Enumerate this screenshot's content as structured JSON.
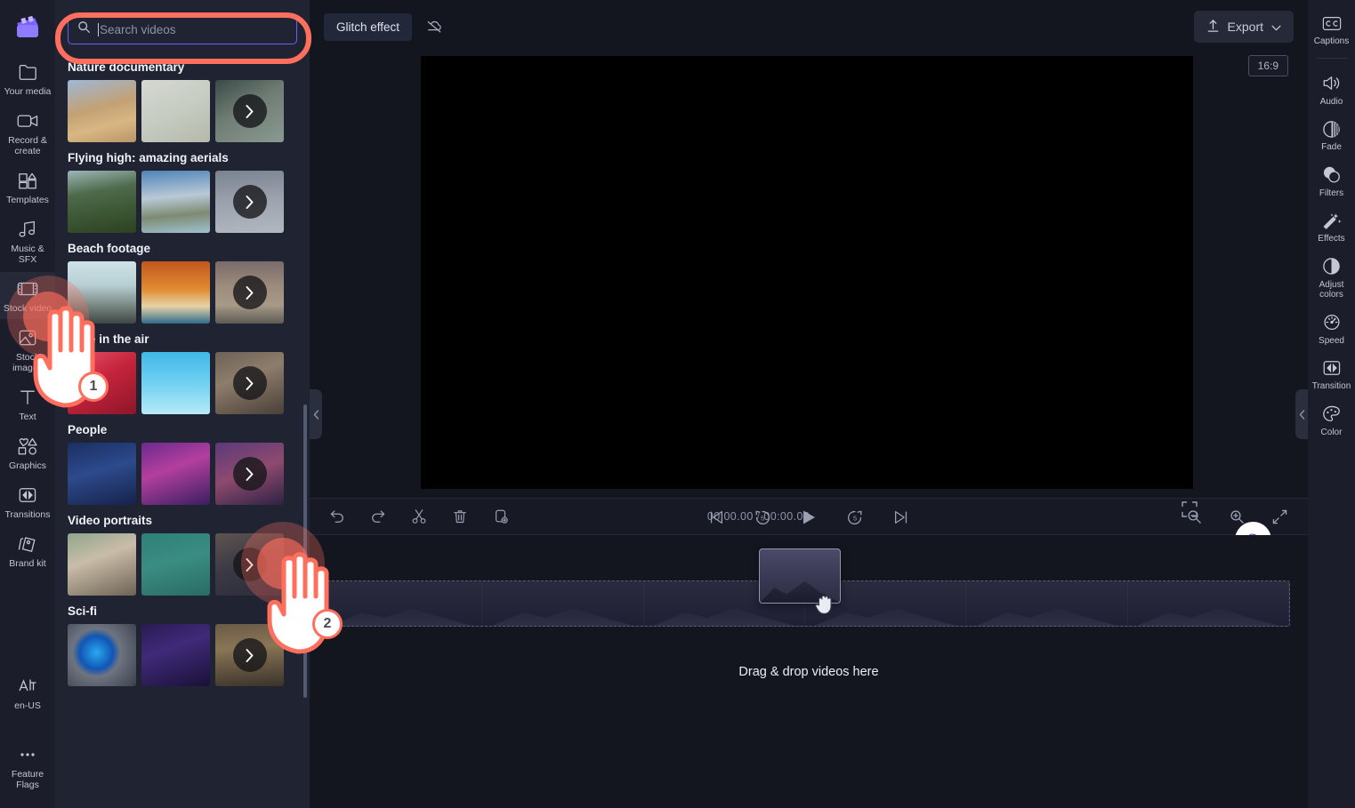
{
  "app": {
    "name": "Clipchamp video editor",
    "accent": "#6a5cff",
    "annotation_color": "#ff6f5e"
  },
  "left_rail": {
    "logo_name": "clipchamp-logo",
    "items": [
      {
        "label": "Your media",
        "icon": "folder-icon",
        "active": false
      },
      {
        "label": "Record & create",
        "icon": "camera-icon",
        "active": false
      },
      {
        "label": "Templates",
        "icon": "templates-icon",
        "active": false
      },
      {
        "label": "Music & SFX",
        "icon": "music-note-icon",
        "active": false
      },
      {
        "label": "Stock video",
        "icon": "film-strip-icon",
        "active": true
      },
      {
        "label": "Stock images",
        "icon": "image-icon",
        "active": false
      },
      {
        "label": "Text",
        "icon": "text-icon",
        "active": false
      },
      {
        "label": "Graphics",
        "icon": "graphics-shapes-icon",
        "active": false
      },
      {
        "label": "Transitions",
        "icon": "transitions-icon",
        "active": false
      },
      {
        "label": "Brand kit",
        "icon": "brand-kit-icon",
        "active": false
      }
    ],
    "bottom_items": [
      {
        "label": "en-US",
        "icon": "language-icon"
      },
      {
        "label": "Feature Flags",
        "icon": "ellipsis-icon"
      }
    ]
  },
  "search": {
    "placeholder": "Search videos",
    "value": "",
    "icon": "search-icon"
  },
  "stock_panel": {
    "more_label": "See more",
    "categories": [
      {
        "title": "Nature documentary",
        "thumbs": [
          {
            "name": "wheat-field-thumb",
            "css": "linear-gradient(165deg,#9fb7d6 0%,#c3a173 45%,#d9b784 70%,#b99466 100%)"
          },
          {
            "name": "grass-sky-thumb",
            "css": "linear-gradient(155deg,#d4d8d2 0%,#c7ccc2 50%,#b4b9ab 100%)"
          },
          {
            "name": "forest-mist-thumb",
            "css": "linear-gradient(150deg,#3a4a46 0%,#6f7d74 45%,#8b9a90 100%)"
          }
        ]
      },
      {
        "title": "Flying high: amazing aerials",
        "thumbs": [
          {
            "name": "green-hill-thumb",
            "css": "linear-gradient(170deg,#9fb6b8 0%,#4d6a4a 35%,#38512f 75%,#2c411f 100%)"
          },
          {
            "name": "snow-mountain-thumb",
            "css": "linear-gradient(175deg,#4f84b8 0%,#b9c9d6 42%,#7d8b72 70%,#9fc2cf 100%)"
          },
          {
            "name": "mountain-range-thumb",
            "css": "linear-gradient(175deg,#7a8290 0%,#9aa1ac 45%,#b2b8c0 100%)"
          }
        ]
      },
      {
        "title": "Beach footage",
        "thumbs": [
          {
            "name": "ocean-shore-thumb",
            "css": "linear-gradient(180deg,#cfe2e8 0%,#b7cfd4 38%,#7f8e8a 68%,#3e4643 100%)"
          },
          {
            "name": "sunset-clouds-thumb",
            "css": "linear-gradient(180deg,#c2571f 0%,#e08b32 45%,#e6d3a6 72%,#2f6b8c 100%)"
          },
          {
            "name": "dusk-sea-thumb",
            "css": "linear-gradient(180deg,#7a6a6a 0%,#9d8c7c 40%,#a89a87 70%,#5d5c54 100%)"
          }
        ]
      },
      {
        "title": "Love in the air",
        "thumbs": [
          {
            "name": "red-hearts-thumb",
            "css": "linear-gradient(150deg,#e8546a 0%,#c4243c 45%,#8e1528 100%)"
          },
          {
            "name": "blue-sky-thumb",
            "css": "linear-gradient(180deg,#3fb7e8 0%,#76d3f2 55%,#b8e9f8 100%)"
          },
          {
            "name": "couple-winter-thumb",
            "css": "linear-gradient(160deg,#6d6256 0%,#8d7d6b 40%,#4a4038 100%)"
          }
        ]
      },
      {
        "title": "People",
        "thumbs": [
          {
            "name": "portrait-blue-thumb",
            "css": "linear-gradient(165deg,#1a2f63 0%,#2d4a8c 45%,#16234a 100%)"
          },
          {
            "name": "neon-headphones-thumb",
            "css": "linear-gradient(160deg,#6b2a8e 0%,#b33f9e 42%,#3a1f5e 100%)"
          },
          {
            "name": "dj-crowd-thumb",
            "css": "linear-gradient(160deg,#5b3a7a 0%,#8e4a6e 48%,#2e2244 100%)"
          }
        ]
      },
      {
        "title": "Video portraits",
        "thumbs": [
          {
            "name": "wedding-couple-thumb",
            "css": "linear-gradient(160deg,#8fa58c 0%,#c9bda8 40%,#6d6255 100%)"
          },
          {
            "name": "woman-teal-thumb",
            "css": "linear-gradient(165deg,#2f8077 0%,#3a8d82 45%,#2a6b63 100%)"
          },
          {
            "name": "phone-filming-thumb",
            "css": "linear-gradient(160deg,#5f5550 0%,#3c3a46 45%,#2a2a38 100%)"
          }
        ]
      },
      {
        "title": "Sci-fi",
        "thumbs": [
          {
            "name": "blue-orb-thumb",
            "css": "radial-gradient(circle at 42% 46%,#2aa8f0 0%,#1056b4 32%,#6e7480 46%,#3a3f4a 100%)"
          },
          {
            "name": "spaceship-earth-thumb",
            "css": "linear-gradient(160deg,#2a1b52 0%,#3f2a7a 40%,#1a1136 100%)"
          },
          {
            "name": "alien-ship-thumb",
            "css": "linear-gradient(175deg,#6a5a46 0%,#8a7556 38%,#3a332a 100%)"
          }
        ]
      }
    ]
  },
  "topbar": {
    "effect_label": "Glitch effect",
    "hide_effect_icon": "effect-off-icon",
    "export_label": "Export",
    "export_icon": "upload-icon",
    "export_chevron": "chevron-down-icon"
  },
  "preview": {
    "aspect_ratio": "16:9",
    "help_label": "?",
    "controls": [
      {
        "name": "skip-to-start-button",
        "icon": "skip-back-icon"
      },
      {
        "name": "rewind-5s-button",
        "icon": "rewind-5-icon"
      },
      {
        "name": "play-button",
        "icon": "play-icon"
      },
      {
        "name": "forward-5s-button",
        "icon": "forward-5-icon"
      },
      {
        "name": "skip-to-end-button",
        "icon": "skip-forward-icon"
      }
    ],
    "fullscreen_icon": "fullscreen-icon"
  },
  "timeline": {
    "tools": [
      {
        "name": "undo-button",
        "icon": "undo-icon"
      },
      {
        "name": "redo-button",
        "icon": "redo-icon"
      },
      {
        "name": "split-button",
        "icon": "scissors-icon"
      },
      {
        "name": "delete-button",
        "icon": "trash-icon"
      },
      {
        "name": "duplicate-button",
        "icon": "duplicate-icon"
      }
    ],
    "current_time": "00:00.00",
    "time_separator": "/",
    "total_time": "00:00.00",
    "zoom_out_icon": "zoom-out-icon",
    "zoom_in_icon": "zoom-in-icon",
    "fit_icon": "fit-to-screen-icon",
    "drop_hint": "Drag & drop videos here",
    "dragged_clip_name": "mountain-clip-thumbnail",
    "cursor_icon": "grab-hand-cursor"
  },
  "right_rail": {
    "items": [
      {
        "label": "Captions",
        "icon": "closed-captions-icon"
      },
      {
        "label": "Audio",
        "icon": "speaker-icon"
      },
      {
        "label": "Fade",
        "icon": "fade-icon"
      },
      {
        "label": "Filters",
        "icon": "filters-circles-icon"
      },
      {
        "label": "Effects",
        "icon": "magic-wand-icon"
      },
      {
        "label": "Adjust colors",
        "icon": "contrast-icon"
      },
      {
        "label": "Speed",
        "icon": "speedometer-icon"
      },
      {
        "label": "Transition",
        "icon": "transition-icon"
      },
      {
        "label": "Color",
        "icon": "palette-icon"
      }
    ]
  },
  "annotations": [
    {
      "number": "1",
      "target": "sidebar-item-stock-video"
    },
    {
      "number": "2",
      "target": "people-see-more-button"
    }
  ]
}
